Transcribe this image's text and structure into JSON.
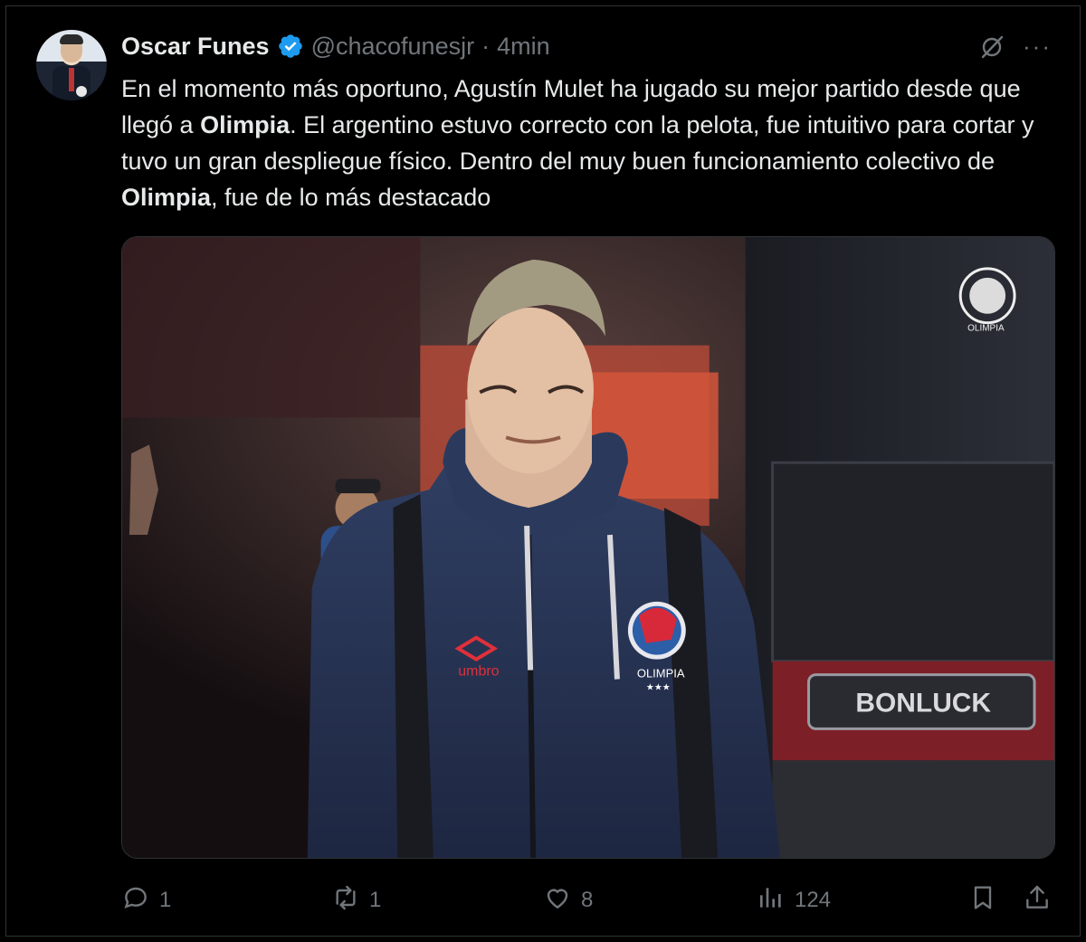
{
  "tweet": {
    "author_name": "Oscar Funes",
    "handle": "@chacofunesjr",
    "separator": "·",
    "time": "4min",
    "more_label": "···",
    "text": {
      "p1": "En el momento más oportuno, Agustín Mulet ha jugado su mejor partido desde que llegó a ",
      "b1": "Olimpia",
      "p2": ". El argentino estuvo correcto con la pelota, fue intuitivo para cortar y tuvo un gran despliegue físico. Dentro del muy buen funcionamiento colectivo de ",
      "b2": "Olimpia",
      "p3": ", fue de lo más destacado"
    },
    "media": {
      "jacket_brand": "umbro",
      "crest_label": "OLIMPIA",
      "crest_stars": "★★★",
      "bus_brand": "BONLUCK",
      "watermark_label": "OLIMPIA"
    },
    "metrics": {
      "replies": "1",
      "reposts": "1",
      "likes": "8",
      "views": "124"
    },
    "icons": {
      "reply": "reply-icon",
      "repost": "repost-icon",
      "like": "heart-icon",
      "views": "views-icon",
      "bookmark": "bookmark-icon",
      "share": "share-icon",
      "grok": "grok-icon",
      "verified": "verified-badge-icon"
    },
    "colors": {
      "background": "#000000",
      "text": "#e7e9ea",
      "muted": "#71767b",
      "verified": "#1d9bf0"
    }
  }
}
